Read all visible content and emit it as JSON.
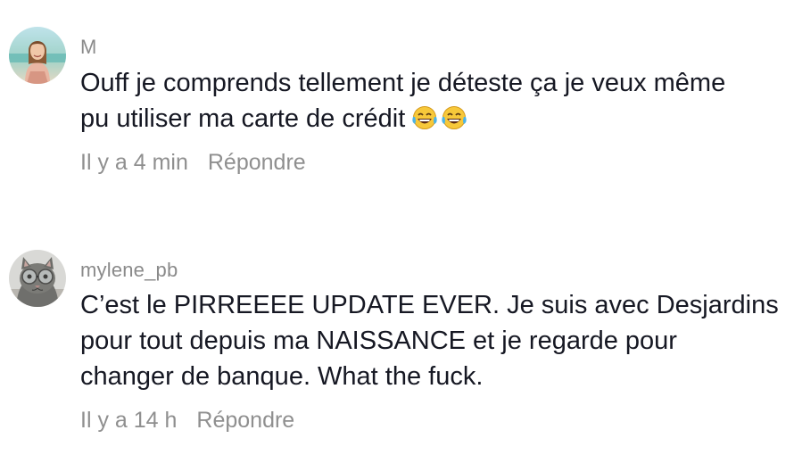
{
  "comments": [
    {
      "username": "M",
      "lines": [
        "Ouff je comprends tellement je déteste ça je veux même",
        "pu utiliser ma carte de crédit"
      ],
      "emoji": "😂😂",
      "time": "Il y a 4 min",
      "reply_label": "Répondre",
      "avatar_icon": "woman-portrait-avatar"
    },
    {
      "username": "mylene_pb",
      "lines": [
        "C’est le PIRREEEE UPDATE EVER. Je suis avec Desjardins",
        "pour tout depuis ma NAISSANCE et je regarde pour",
        "changer de banque. What the fuck."
      ],
      "time": "Il y a 14 h",
      "reply_label": "Répondre",
      "avatar_icon": "cat-with-glasses-avatar"
    }
  ],
  "colors": {
    "text": "#161823",
    "muted": "#8f8f8f",
    "background": "#ffffff"
  }
}
